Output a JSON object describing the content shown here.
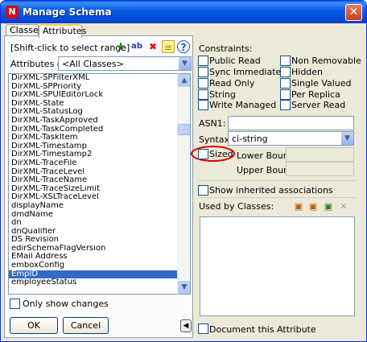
{
  "window": {
    "title": "Manage Schema",
    "app_icon": "novell-n-icon",
    "close_glyph": "✕"
  },
  "tabs": [
    {
      "label": "Classes"
    },
    {
      "label": "Attributes"
    }
  ],
  "left": {
    "hint": "[Shift-click to select range]",
    "attrs_of_label": "Attributes of:",
    "attrs_of_value": "<All Classes>",
    "items": [
      "DirXML-SPFilterXML",
      "DirXML-SPPriority",
      "DirXML-SPUIEditorLock",
      "DirXML-State",
      "DirXML-StatusLog",
      "DirXML-TaskApproved",
      "DirXML-TaskCompleted",
      "DirXML-TaskItem",
      "DirXML-Timestamp",
      "DirXML-Timestamp2",
      "DirXML-TraceFile",
      "DirXML-TraceLevel",
      "DirXML-TraceName",
      "DirXML-TraceSizeLimit",
      "DirXML-XSLTraceLevel",
      "displayName",
      "dmdName",
      "dn",
      "dnQualifier",
      "DS Revision",
      "edirSchemaFlagVersion",
      "EMail Address",
      "emboxConfig",
      "EmpID",
      "employeeStatus"
    ],
    "selected_item": "EmpID",
    "only_show_changes_label": "Only show changes",
    "ok_label": "OK",
    "cancel_label": "Cancel",
    "collapse_glyph": "◀"
  },
  "toolbar_icons": [
    "new-attribute-icon",
    "rename-attribute-icon",
    "delete-icon",
    "extend-icon",
    "help-icon"
  ],
  "right": {
    "constraints_label": "Constraints:",
    "constraints_left": [
      "Public Read",
      "Sync Immediate",
      "Read Only",
      "String",
      "Write Managed"
    ],
    "constraints_right": [
      "Non Removable",
      "Hidden",
      "Single Valued",
      "Per Replica",
      "Server Read"
    ],
    "asn1_label": "ASN1:",
    "asn1_value": "",
    "syntax_label": "Syntax:",
    "syntax_value": "ci-string",
    "sized_label": "Sized",
    "lower_bound_label": "Lower Bound:",
    "upper_bound_label": "Upper Bound:",
    "show_inherited_label": "Show inherited associations",
    "used_by_label": "Used by Classes:",
    "used_by_icons": [
      "add-class-icon",
      "edit-class-icon",
      "copy-class-icon",
      "remove-class-icon"
    ],
    "document_label": "Document this Attribute"
  },
  "colors": {
    "title_bar": "#0a5fe6",
    "selection": "#316ac5",
    "annotation_circle": "#e00000"
  }
}
